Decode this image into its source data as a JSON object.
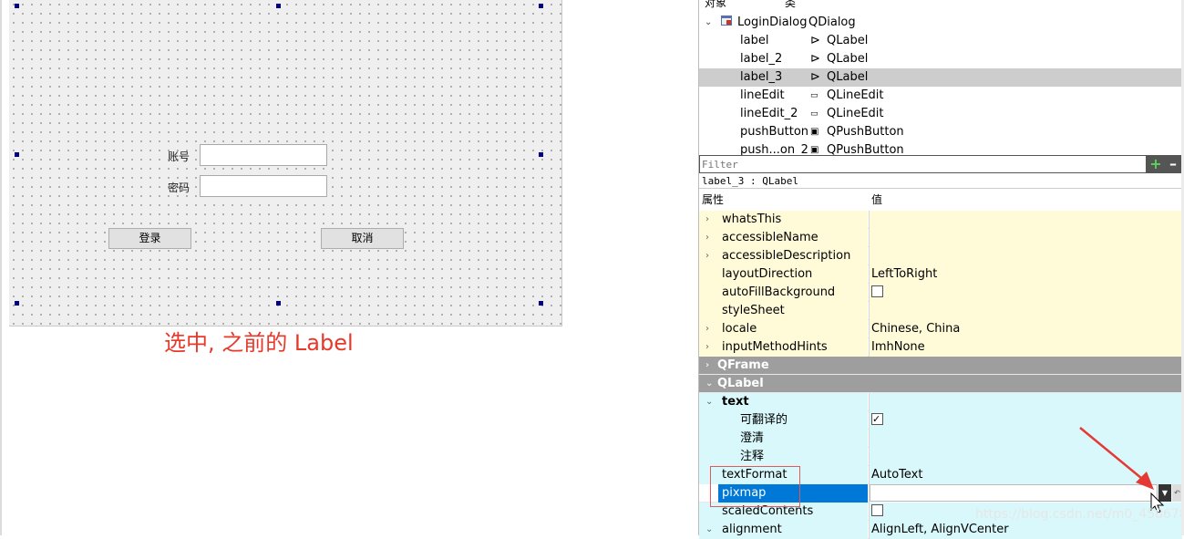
{
  "object_inspector": {
    "header_object": "对象",
    "header_class": "类",
    "rows": [
      {
        "name": "LoginDialog",
        "class": "QDialog",
        "expanded": true
      },
      {
        "name": "label",
        "class": "QLabel"
      },
      {
        "name": "label_2",
        "class": "QLabel"
      },
      {
        "name": "label_3",
        "class": "QLabel",
        "selected": true
      },
      {
        "name": "lineEdit",
        "class": "QLineEdit"
      },
      {
        "name": "lineEdit_2",
        "class": "QLineEdit"
      },
      {
        "name": "pushButton",
        "class": "QPushButton"
      },
      {
        "name": "push...on_2",
        "class": "QPushButton"
      }
    ]
  },
  "form": {
    "account_label": "账号",
    "password_label": "密码",
    "login_button": "登录",
    "cancel_button": "取消"
  },
  "annotation": "选中, 之前的 Label",
  "property_editor": {
    "filter_placeholder": "Filter",
    "add_icon": "plus-icon",
    "remove_icon": "minus-icon",
    "object_info": "label_3 : QLabel",
    "col_property": "属性",
    "col_value": "值",
    "rows": [
      {
        "name": "whatsThis",
        "value": "",
        "style": "yellow",
        "arrow": "›"
      },
      {
        "name": "accessibleName",
        "value": "",
        "style": "yellow",
        "arrow": "›"
      },
      {
        "name": "accessibleDescription",
        "value": "",
        "style": "yellow",
        "arrow": "›"
      },
      {
        "name": "layoutDirection",
        "value": "LeftToRight",
        "style": "yellow",
        "arrow": ""
      },
      {
        "name": "autoFillBackground",
        "value": "",
        "style": "yellow",
        "arrow": "",
        "checkbox": false
      },
      {
        "name": "styleSheet",
        "value": "",
        "style": "yellow",
        "arrow": ""
      },
      {
        "name": "locale",
        "value": "Chinese, China",
        "style": "yellow",
        "arrow": "›"
      },
      {
        "name": "inputMethodHints",
        "value": "ImhNone",
        "style": "yellow",
        "arrow": "›"
      },
      {
        "name": "QFrame",
        "value": "",
        "style": "group",
        "arrow": "›"
      },
      {
        "name": "QLabel",
        "value": "",
        "style": "group",
        "arrow": "⌄"
      },
      {
        "name": "text",
        "value": "",
        "style": "cyan",
        "arrow": "⌄",
        "bold": true
      },
      {
        "name": "可翻译的",
        "value": "",
        "style": "cyan",
        "arrow": "",
        "sub": true,
        "checkbox": true
      },
      {
        "name": "澄清",
        "value": "",
        "style": "cyan",
        "arrow": "",
        "sub": true
      },
      {
        "name": "注释",
        "value": "",
        "style": "cyan",
        "arrow": "",
        "sub": true
      },
      {
        "name": "textFormat",
        "value": "AutoText",
        "style": "cyan",
        "arrow": ""
      },
      {
        "name": "pixmap",
        "value": "",
        "style": "cyan",
        "arrow": "",
        "highlight": true
      },
      {
        "name": "scaledContents",
        "value": "",
        "style": "cyan",
        "arrow": "",
        "checkbox": false
      },
      {
        "name": "alignment",
        "value": "AlignLeft, AlignVCenter",
        "style": "cyan",
        "arrow": "⌄"
      }
    ]
  },
  "watermark": "https://blog.csdn.net/m0_45867846",
  "colors": {
    "annotation": "#e8382a",
    "selection": "#0078d7",
    "yellow_row": "#fffbd8",
    "cyan_row": "#d9f8fb",
    "group_row": "#9e9e9e"
  }
}
